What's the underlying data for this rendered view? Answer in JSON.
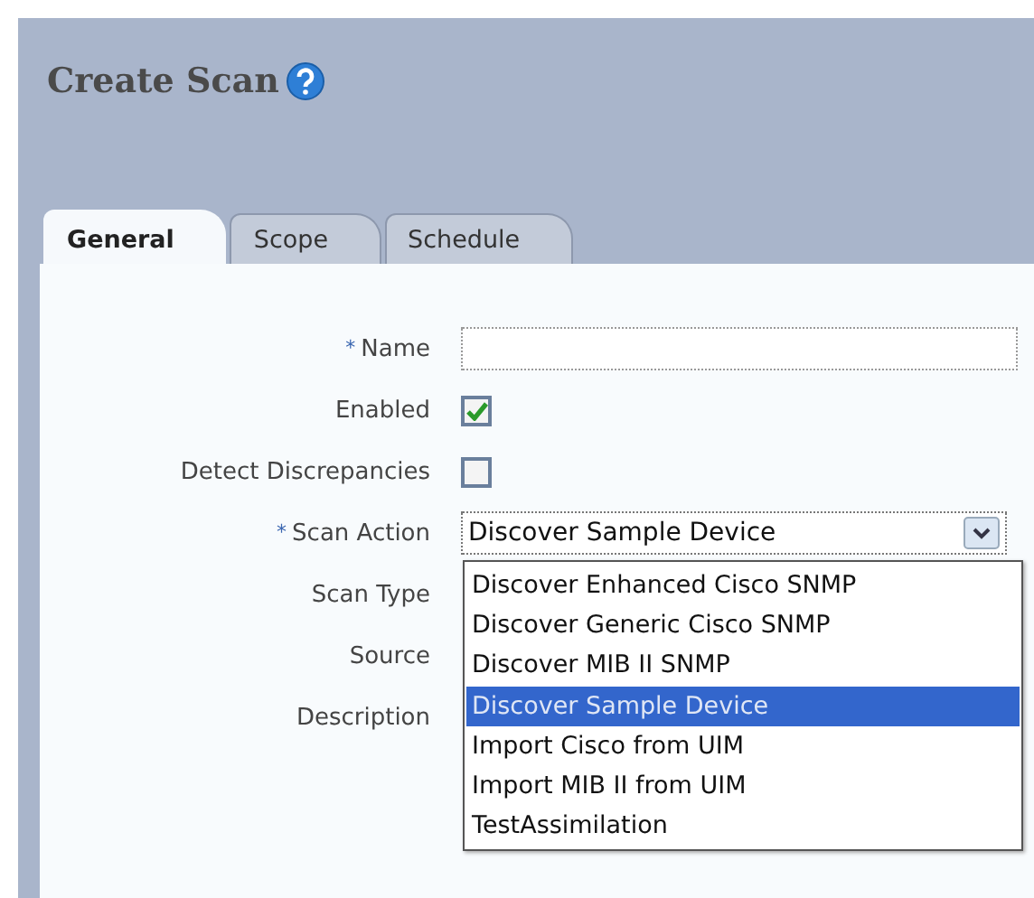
{
  "title": "Create Scan",
  "tabs": [
    {
      "label": "General",
      "selected": true
    },
    {
      "label": "Scope",
      "selected": false
    },
    {
      "label": "Schedule",
      "selected": false
    }
  ],
  "fields": [
    {
      "label": "Name",
      "required": true,
      "kind": "text"
    },
    {
      "label": "Enabled",
      "required": false,
      "kind": "checkbox",
      "checked": true
    },
    {
      "label": "Detect Discrepancies",
      "required": false,
      "kind": "checkbox",
      "checked": false
    },
    {
      "label": "Scan Action",
      "required": true,
      "kind": "select",
      "value": "Discover Sample Device"
    },
    {
      "label": "Scan Type",
      "required": false,
      "kind": "hidden"
    },
    {
      "label": "Source",
      "required": false,
      "kind": "hidden"
    },
    {
      "label": "Description",
      "required": false,
      "kind": "hidden"
    }
  ],
  "required_mark": "*",
  "dropdown_options": [
    {
      "label": "Discover Enhanced Cisco SNMP",
      "selected": false
    },
    {
      "label": "Discover Generic Cisco SNMP",
      "selected": false
    },
    {
      "label": "Discover MIB II SNMP",
      "selected": false
    },
    {
      "label": "Discover Sample Device",
      "selected": true
    },
    {
      "label": "Import Cisco from UIM",
      "selected": false
    },
    {
      "label": "Import MIB II from UIM",
      "selected": false
    },
    {
      "label": "TestAssimilation",
      "selected": false
    }
  ]
}
